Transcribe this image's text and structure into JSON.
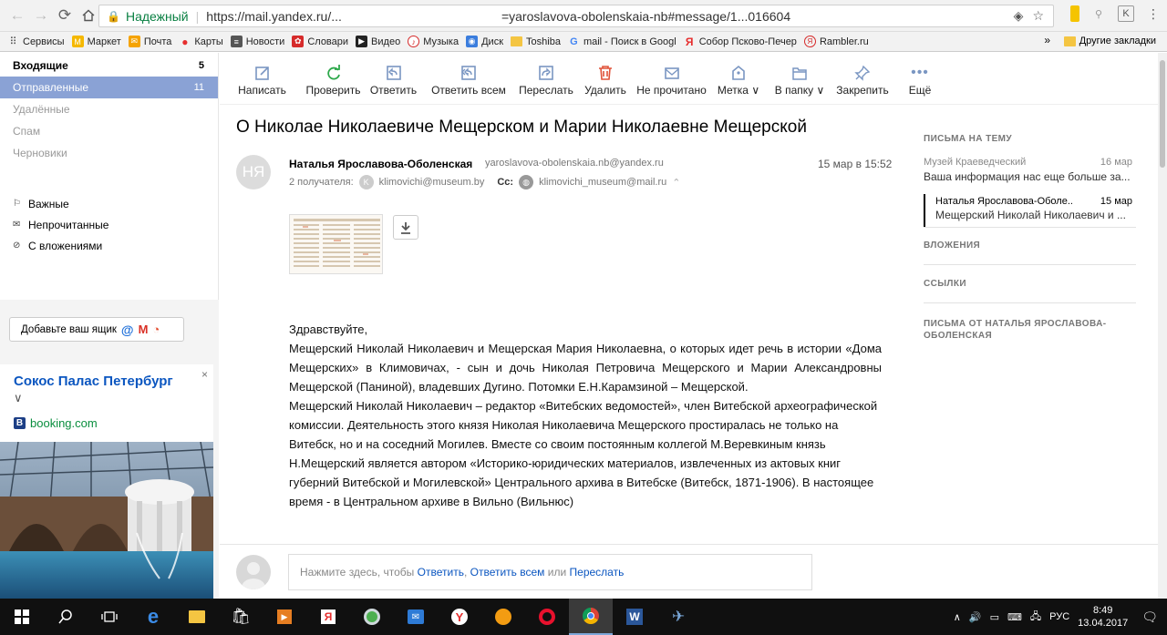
{
  "browser": {
    "secure_label": "Надежный",
    "url_start": "https://mail.yandex.ru/...",
    "url_end": "=yaroslavova-obolenskaia-nb#message/1...016604"
  },
  "bookmarks": {
    "items": [
      {
        "label": "Сервисы",
        "icon": "apps-grid-icon",
        "color": "#4a4a4a"
      },
      {
        "label": "Маркет",
        "icon": "market-icon",
        "color": "#f5b800"
      },
      {
        "label": "Почта",
        "icon": "mail-icon",
        "color": "#f5a300"
      },
      {
        "label": "Карты",
        "icon": "map-pin-icon",
        "color": "#e62e2e"
      },
      {
        "label": "Новости",
        "icon": "news-icon",
        "color": "#4a4a4a"
      },
      {
        "label": "Словари",
        "icon": "dictionary-icon",
        "color": "#d62b2b"
      },
      {
        "label": "Видео",
        "icon": "video-icon",
        "color": "#222222"
      },
      {
        "label": "Музыка",
        "icon": "music-icon",
        "color": "#d62b2b"
      },
      {
        "label": "Диск",
        "icon": "disk-icon",
        "color": "#3b7ddd"
      },
      {
        "label": "Toshiba",
        "icon": "folder-icon",
        "color": "#f4c542"
      },
      {
        "label": "mail - Поиск в Googl",
        "icon": "google-icon",
        "color": "#4285f4"
      },
      {
        "label": "Собор Псково-Печер",
        "icon": "yandex-icon",
        "color": "#e62e2e"
      },
      {
        "label": "Rambler.ru",
        "icon": "rambler-icon",
        "color": "#d62b2b"
      }
    ],
    "more": "»",
    "other": "Другие закладки"
  },
  "sidebar": {
    "folders": [
      {
        "label": "Входящие",
        "count": "5",
        "style": "bold"
      },
      {
        "label": "Отправленные",
        "count": "11",
        "style": "active"
      },
      {
        "label": "Удалённые",
        "count": "",
        "style": "grey"
      },
      {
        "label": "Спам",
        "count": "",
        "style": "grey"
      },
      {
        "label": "Черновики",
        "count": "",
        "style": "grey"
      }
    ],
    "filters": [
      {
        "label": "Важные",
        "icon": "flag-icon"
      },
      {
        "label": "Непрочитанные",
        "icon": "envelope-icon"
      },
      {
        "label": "С вложениями",
        "icon": "paperclip-icon"
      }
    ],
    "add_mailbox": "Добавьте ваш ящик"
  },
  "ad": {
    "title": "Сокос Палас Петербург",
    "source": "booking.com",
    "close": "×"
  },
  "toolbar": {
    "buttons": [
      {
        "label": "Написать",
        "icon": "compose-icon"
      },
      {
        "label": "Проверить",
        "icon": "refresh-icon"
      },
      {
        "label": "Ответить",
        "icon": "reply-icon"
      },
      {
        "label": "Ответить всем",
        "icon": "reply-all-icon"
      },
      {
        "label": "Переслать",
        "icon": "forward-icon"
      },
      {
        "label": "Удалить",
        "icon": "trash-icon"
      },
      {
        "label": "Не прочитано",
        "icon": "unread-icon"
      },
      {
        "label": "Метка ∨",
        "icon": "label-icon"
      },
      {
        "label": "В папку ∨",
        "icon": "folder-move-icon"
      },
      {
        "label": "Закрепить",
        "icon": "pin-icon"
      },
      {
        "label": "Ещё",
        "icon": "more-icon"
      }
    ]
  },
  "message": {
    "subject": "О Николае Николаевиче Мещерском и Марии Николаевне Мещерской",
    "avatar_initials": "НЯ",
    "sender_name": "Наталья Ярославова-Оболенская",
    "sender_email": "yaroslavova-obolenskaia.nb@yandex.ru",
    "date": "15 мар в 15:52",
    "recipients_label": "2 получателя:",
    "recipient1": "klimovichi@museum.by",
    "cc_label": "Cc:",
    "recipient2": "klimovichi_museum@mail.ru",
    "greeting": "Здравствуйте,",
    "para1": "Мещерский Николай Николаевич и Мещерская Мария Николаевна, о которых идет речь в истории «Дома Мещерских» в Климовичах, - сын и дочь Николая Петровича Мещерского и Марии Александровны Мещерской (Паниной), владевших Дугино. Потомки Е.Н.Карамзиной – Мещерской.",
    "para2": "Мещерский Николай Николаевич – редактор «Витебских ведомостей», член Витебской археографической комиссии. Деятельность этого князя Николая Николаевича Мещерского простиралась не только на Витебск, но и на соседний Могилев. Вместе со своим постоянным коллегой М.Веревкиным князь Н.Мещерский является автором «Историко-юридических материалов, извлеченных из актовых книг губерний Витебской и Могилевской» Центрального архива в Витебске (Витебск, 1871-1906). В настоящее время - в Центральном архиве в Вильно (Вильнюс)"
  },
  "reply": {
    "prefix": "Нажмите здесь, чтобы",
    "reply": "Ответить",
    "reply_all": "Ответить всем",
    "or": "или",
    "forward": "Переслать"
  },
  "rightpanel": {
    "thread_heading": "Письма на тему",
    "thread": [
      {
        "from": "Музей Краеведческий",
        "date": "16 мар",
        "snippet": "Ваша информация нас еще больше за..."
      },
      {
        "from": "Наталья Ярославова-Оболе..",
        "date": "15 мар",
        "snippet": "Мещерский Николай Николаевич и ..."
      }
    ],
    "attachments_heading": "Вложения",
    "links_heading": "Ссылки",
    "from_heading": "Письма от Наталья Ярославова-Оболенская"
  },
  "taskbar": {
    "lang": "РУС",
    "time": "8:49",
    "date": "13.04.2017"
  }
}
